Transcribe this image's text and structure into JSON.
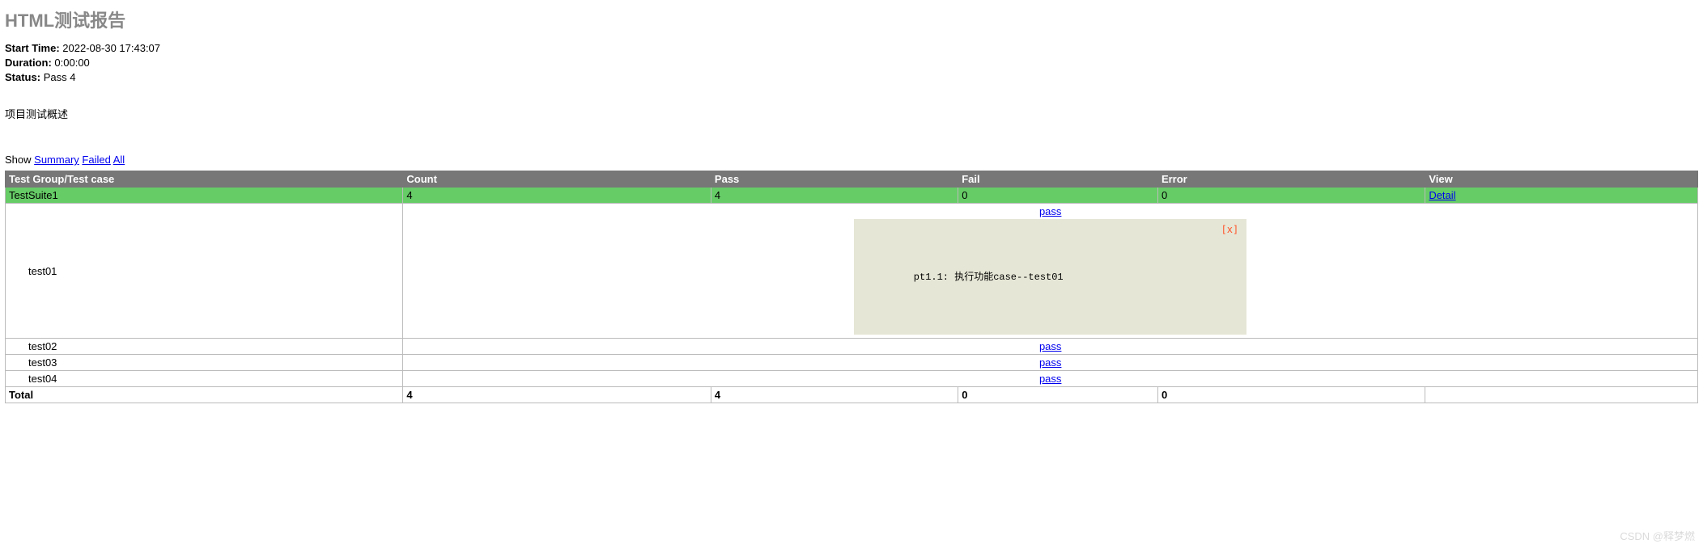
{
  "title": "HTML测试报告",
  "meta": {
    "start_label": "Start Time:",
    "start_value": "2022-08-30 17:43:07",
    "duration_label": "Duration:",
    "duration_value": "0:00:00",
    "status_label": "Status:",
    "status_value": "Pass 4"
  },
  "description": "项目测试概述",
  "show": {
    "prefix": "Show",
    "summary": "Summary",
    "failed": "Failed",
    "all": "All"
  },
  "headers": {
    "group": "Test Group/Test case",
    "count": "Count",
    "pass": "Pass",
    "fail": "Fail",
    "error": "Error",
    "view": "View"
  },
  "suite": {
    "name": "TestSuite1",
    "count": "4",
    "pass": "4",
    "fail": "0",
    "error": "0",
    "view": "Detail"
  },
  "case1": {
    "name": "test01",
    "status": "pass",
    "close": "[x]",
    "output": "pt1.1: 执行功能case--test01"
  },
  "case2": {
    "name": "test02",
    "status": "pass"
  },
  "case3": {
    "name": "test03",
    "status": "pass"
  },
  "case4": {
    "name": "test04",
    "status": "pass"
  },
  "total": {
    "label": "Total",
    "count": "4",
    "pass": "4",
    "fail": "0",
    "error": "0"
  },
  "watermark": "CSDN @释梦燃"
}
